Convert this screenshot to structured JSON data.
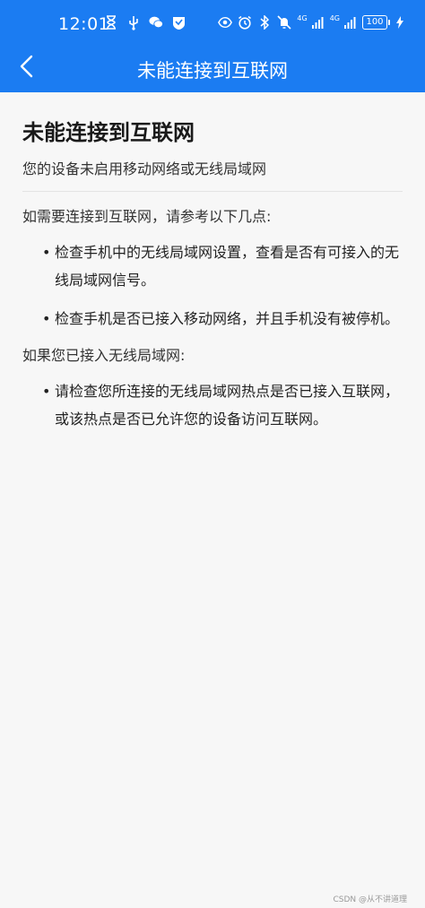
{
  "status_bar": {
    "time": "12:01",
    "network_tag_1": "4G",
    "network_tag_2": "4G",
    "battery": "100"
  },
  "app_bar": {
    "title": "未能连接到互联网"
  },
  "page": {
    "title": "未能连接到互联网",
    "subtitle": "您的设备未启用移动网络或无线局域网",
    "section1": {
      "heading": "如需要连接到互联网，请参考以下几点:",
      "items": [
        "检查手机中的无线局域网设置，查看是否有可接入的无线局域网信号。",
        "检查手机是否已接入移动网络，并且手机没有被停机。"
      ]
    },
    "section2": {
      "heading": "如果您已接入无线局域网:",
      "items": [
        "请检查您所连接的无线局域网热点是否已接入互联网，或该热点是否已允许您的设备访问互联网。"
      ]
    }
  },
  "watermark": "CSDN @从不讲道理",
  "colors": {
    "accent": "#1b7cf2",
    "background": "#f7f7f7"
  }
}
